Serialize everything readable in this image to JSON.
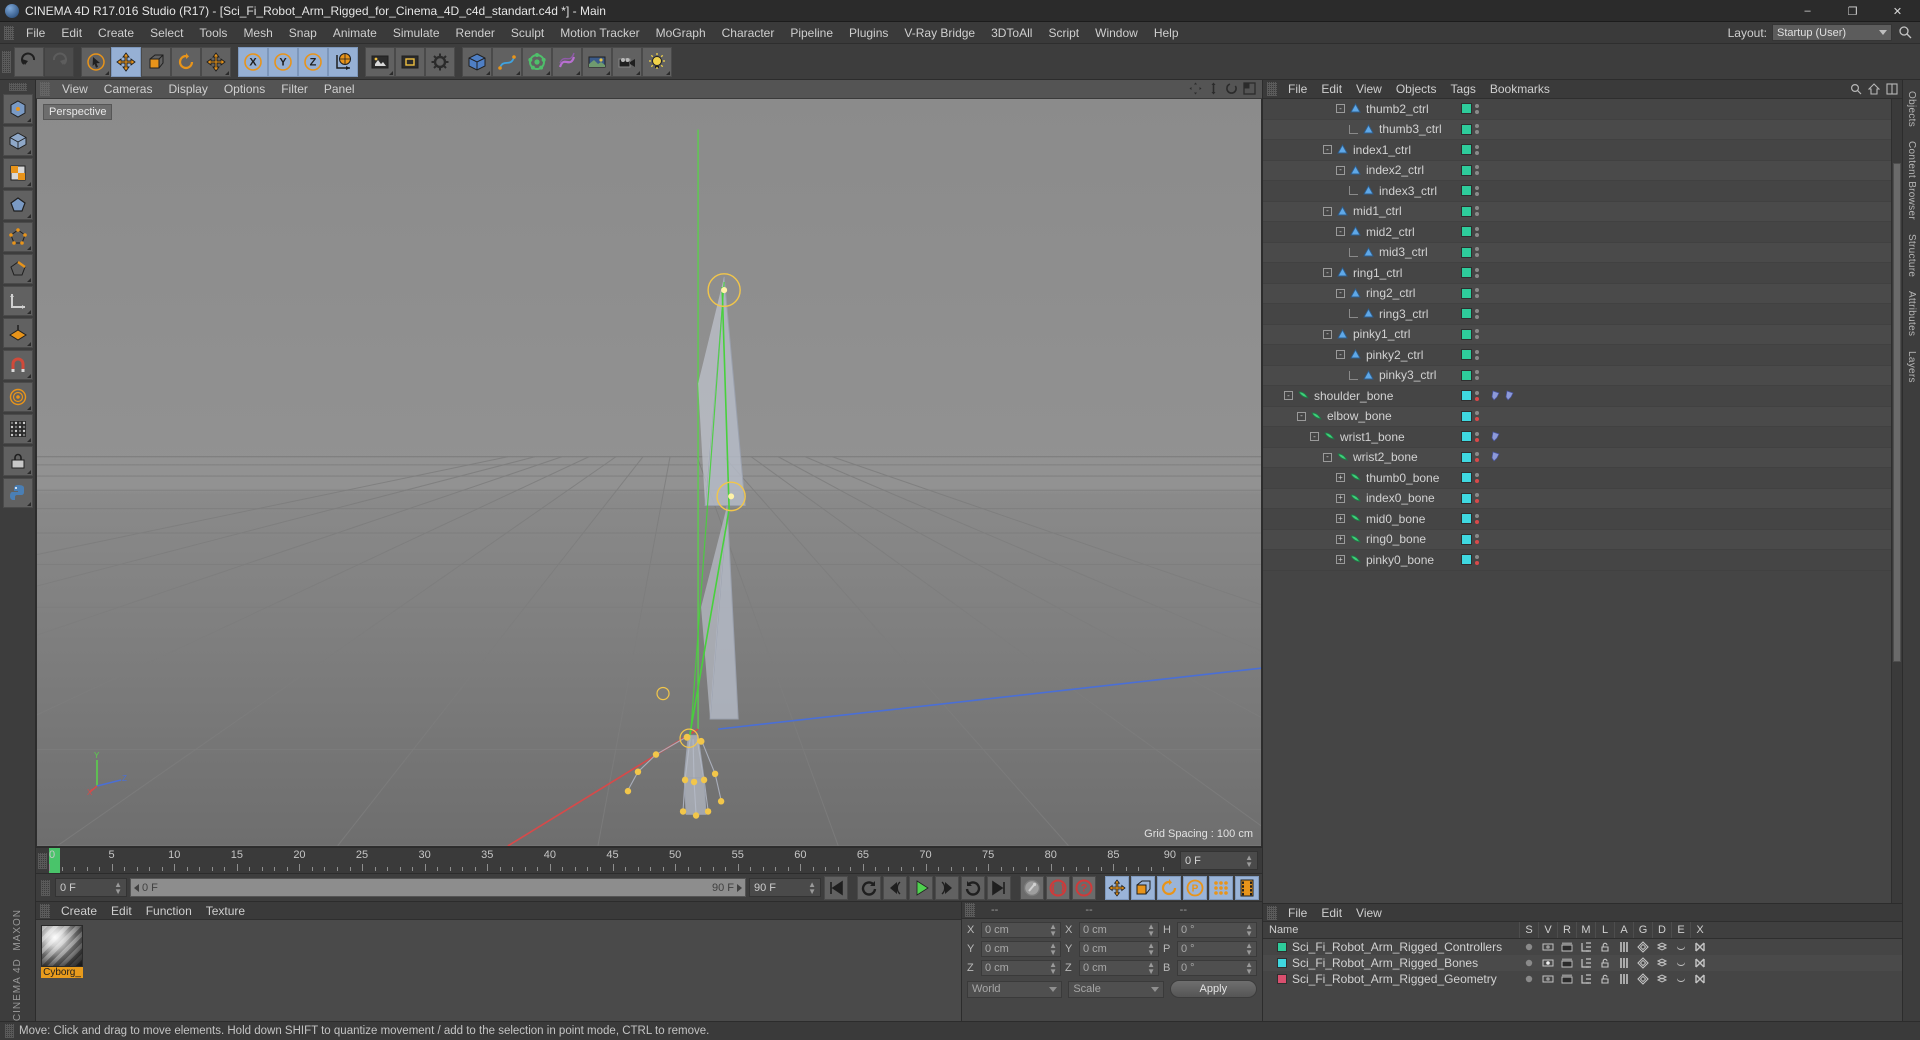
{
  "window": {
    "title": "CINEMA 4D R17.016 Studio (R17) - [Sci_Fi_Robot_Arm_Rigged_for_Cinema_4D_c4d_standart.c4d *] - Main",
    "minimize": "–",
    "maximize": "❐",
    "close": "✕",
    "brand_line1": "MAXON",
    "brand_line2": "CINEMA 4D"
  },
  "menubar": {
    "items": [
      "File",
      "Edit",
      "Create",
      "Select",
      "Tools",
      "Mesh",
      "Snap",
      "Animate",
      "Simulate",
      "Render",
      "Sculpt",
      "Motion Tracker",
      "MoGraph",
      "Character",
      "Pipeline",
      "Plugins",
      "V-Ray Bridge",
      "3DToAll",
      "Script",
      "Window",
      "Help"
    ],
    "layout_label": "Layout:",
    "layout_value": "Startup (User)",
    "search_icon": "search-icon"
  },
  "toolbar": {
    "groups": [
      {
        "buttons": [
          {
            "name": "undo-button",
            "icon": "undo-icon",
            "state": "normal"
          },
          {
            "name": "redo-button",
            "icon": "redo-icon",
            "state": "disabled"
          }
        ]
      },
      {
        "buttons": [
          {
            "name": "live-selection-button",
            "icon": "cursor-select-icon",
            "state": "normal",
            "corner": true
          },
          {
            "name": "move-tool-button",
            "icon": "move-arrows-icon",
            "state": "active"
          },
          {
            "name": "scale-tool-button",
            "icon": "scale-box-icon",
            "state": "normal"
          },
          {
            "name": "rotate-tool-button",
            "icon": "rotate-circle-icon",
            "state": "normal"
          },
          {
            "name": "move-variant-button",
            "icon": "move-arrows-icon",
            "state": "normal",
            "corner": true
          }
        ]
      },
      {
        "buttons": [
          {
            "name": "lock-x-axis-button",
            "icon": "axis-x-icon",
            "state": "active"
          },
          {
            "name": "lock-y-axis-button",
            "icon": "axis-y-icon",
            "state": "active"
          },
          {
            "name": "lock-z-axis-button",
            "icon": "axis-z-icon",
            "state": "active"
          },
          {
            "name": "world-coordinate-button",
            "icon": "globe-axis-icon",
            "state": "active"
          }
        ]
      },
      {
        "buttons": [
          {
            "name": "render-view-button",
            "icon": "render-frame-icon",
            "state": "normal",
            "corner": true
          },
          {
            "name": "render-region-button",
            "icon": "render-region-icon",
            "state": "normal"
          },
          {
            "name": "render-settings-button",
            "icon": "render-settings-icon",
            "state": "normal"
          }
        ]
      },
      {
        "buttons": [
          {
            "name": "add-cube-button",
            "icon": "cube-icon",
            "state": "normal",
            "corner": true
          },
          {
            "name": "add-spline-button",
            "icon": "spline-pen-icon",
            "state": "normal",
            "corner": true
          },
          {
            "name": "add-generator-button",
            "icon": "generator-icon",
            "state": "normal",
            "corner": true
          },
          {
            "name": "add-deformer-button",
            "icon": "deformer-icon",
            "state": "normal",
            "corner": true
          },
          {
            "name": "add-scene-object-button",
            "icon": "environment-icon",
            "state": "normal",
            "corner": true
          },
          {
            "name": "add-camera-button",
            "icon": "camera-icon",
            "state": "normal",
            "corner": true
          },
          {
            "name": "add-light-button",
            "icon": "light-icon",
            "state": "normal",
            "corner": true
          }
        ]
      }
    ]
  },
  "left_palette": {
    "buttons": [
      {
        "name": "make-editable-button",
        "icon": "make-editable-icon"
      },
      {
        "name": "model-mode-button",
        "icon": "model-cube-icon"
      },
      {
        "name": "texture-mode-button",
        "icon": "texture-checker-icon"
      },
      {
        "name": "polygon-mode-button",
        "icon": "polygon-icon"
      },
      {
        "name": "point-mode-button",
        "icon": "point-icon"
      },
      {
        "name": "edge-mode-button",
        "icon": "edge-icon"
      },
      {
        "name": "object-axis-button",
        "icon": "axis-corner-icon"
      },
      {
        "name": "workplane-button",
        "icon": "workplane-icon"
      },
      {
        "name": "snap-toggle-button",
        "icon": "snap-magnet-icon"
      },
      {
        "name": "soft-selection-button",
        "icon": "soft-selection-icon"
      },
      {
        "name": "viewport-solo-button",
        "icon": "solo-grid-icon"
      },
      {
        "name": "lock-selection-button",
        "icon": "lock-icon"
      },
      {
        "name": "python-button",
        "icon": "python-icon"
      }
    ]
  },
  "viewport": {
    "menu": [
      "View",
      "Cameras",
      "Display",
      "Options",
      "Filter",
      "Panel"
    ],
    "label": "Perspective",
    "grid_spacing": "Grid Spacing : 100 cm",
    "nav_icons": [
      "pan-icon",
      "zoom-icon",
      "rotate-icon",
      "maximize-viewport-icon"
    ],
    "axis_labels": {
      "y": "Y",
      "z": "Z",
      "x": "X"
    }
  },
  "timeline": {
    "start": 0,
    "end": 90,
    "major_ticks": [
      0,
      5,
      10,
      15,
      20,
      25,
      30,
      35,
      40,
      45,
      50,
      55,
      60,
      65,
      70,
      75,
      80,
      85,
      90
    ],
    "current_frame_field": "0 F",
    "playhead_frame": 0
  },
  "transport": {
    "current_frame": "0 F",
    "range_start": "0 F",
    "range_end": "90 F",
    "preview_end": "90 F",
    "buttons": [
      {
        "name": "go-to-start-button",
        "icon": "skip-start-icon"
      },
      {
        "name": "play-backwards-button",
        "icon": "rewind-loop-icon"
      },
      {
        "name": "previous-frame-button",
        "icon": "step-back-icon"
      },
      {
        "name": "play-forward-button",
        "icon": "play-icon"
      },
      {
        "name": "next-frame-button",
        "icon": "step-forward-icon"
      },
      {
        "name": "play-forward-loop-button",
        "icon": "forward-loop-icon"
      },
      {
        "name": "go-to-end-button",
        "icon": "skip-end-icon"
      },
      {
        "name": "record-active-objects-button",
        "icon": "record-key-icon"
      },
      {
        "name": "autokeying-button",
        "icon": "autokey-icon"
      },
      {
        "name": "keyframe-selection-button",
        "icon": "keyframe-question-icon"
      },
      {
        "name": "position-key-button",
        "icon": "position-key-icon"
      },
      {
        "name": "scale-key-button",
        "icon": "scale-key-icon"
      },
      {
        "name": "rotation-key-button",
        "icon": "rotation-key-icon"
      },
      {
        "name": "param-key-button",
        "icon": "param-key-icon"
      },
      {
        "name": "point-level-anim-button",
        "icon": "pla-dots-icon"
      },
      {
        "name": "timeline-button",
        "icon": "filmstrip-icon"
      }
    ]
  },
  "material_manager": {
    "menu": [
      "Create",
      "Edit",
      "Function",
      "Texture"
    ],
    "materials": [
      {
        "name": "Cyborg_",
        "selected": true
      }
    ]
  },
  "coordinate_manager": {
    "headers": [
      "--",
      "--",
      "--"
    ],
    "rows": [
      {
        "pos_label": "X",
        "pos_value": "0 cm",
        "size_label": "X",
        "size_value": "0 cm",
        "rot_label": "H",
        "rot_value": "0 °"
      },
      {
        "pos_label": "Y",
        "pos_value": "0 cm",
        "size_label": "Y",
        "size_value": "0 cm",
        "rot_label": "P",
        "rot_value": "0 °"
      },
      {
        "pos_label": "Z",
        "pos_value": "0 cm",
        "size_label": "Z",
        "size_value": "0 cm",
        "rot_label": "B",
        "rot_value": "0 °"
      }
    ],
    "coord_system": "World",
    "transform_mode": "Scale",
    "apply_label": "Apply"
  },
  "object_manager": {
    "menu": [
      "File",
      "Edit",
      "View",
      "Objects",
      "Tags",
      "Bookmarks"
    ],
    "rows": [
      {
        "label": "thumb2_ctrl",
        "type": "ctrl",
        "indent": 5,
        "expander": "-",
        "chip": "#2ecc9b",
        "tags": [
          "dot-gray",
          "dot-gray"
        ],
        "extra": []
      },
      {
        "label": "thumb3_ctrl",
        "type": "ctrl",
        "indent": 6,
        "expander": "leaf",
        "chip": "#2ecc9b",
        "tags": [
          "dot-gray",
          "dot-gray"
        ],
        "extra": []
      },
      {
        "label": "index1_ctrl",
        "type": "ctrl",
        "indent": 4,
        "expander": "-",
        "chip": "#2ecc9b",
        "tags": [
          "dot-gray",
          "dot-gray"
        ],
        "extra": []
      },
      {
        "label": "index2_ctrl",
        "type": "ctrl",
        "indent": 5,
        "expander": "-",
        "chip": "#2ecc9b",
        "tags": [
          "dot-gray",
          "dot-gray"
        ],
        "extra": []
      },
      {
        "label": "index3_ctrl",
        "type": "ctrl",
        "indent": 6,
        "expander": "leaf",
        "chip": "#2ecc9b",
        "tags": [
          "dot-gray",
          "dot-gray"
        ],
        "extra": []
      },
      {
        "label": "mid1_ctrl",
        "type": "ctrl",
        "indent": 4,
        "expander": "-",
        "chip": "#2ecc9b",
        "tags": [
          "dot-gray",
          "dot-gray"
        ],
        "extra": []
      },
      {
        "label": "mid2_ctrl",
        "type": "ctrl",
        "indent": 5,
        "expander": "-",
        "chip": "#2ecc9b",
        "tags": [
          "dot-gray",
          "dot-gray"
        ],
        "extra": []
      },
      {
        "label": "mid3_ctrl",
        "type": "ctrl",
        "indent": 6,
        "expander": "leaf",
        "chip": "#2ecc9b",
        "tags": [
          "dot-gray",
          "dot-gray"
        ],
        "extra": []
      },
      {
        "label": "ring1_ctrl",
        "type": "ctrl",
        "indent": 4,
        "expander": "-",
        "chip": "#2ecc9b",
        "tags": [
          "dot-gray",
          "dot-gray"
        ],
        "extra": []
      },
      {
        "label": "ring2_ctrl",
        "type": "ctrl",
        "indent": 5,
        "expander": "-",
        "chip": "#2ecc9b",
        "tags": [
          "dot-gray",
          "dot-gray"
        ],
        "extra": []
      },
      {
        "label": "ring3_ctrl",
        "type": "ctrl",
        "indent": 6,
        "expander": "leaf",
        "chip": "#2ecc9b",
        "tags": [
          "dot-gray",
          "dot-gray"
        ],
        "extra": []
      },
      {
        "label": "pinky1_ctrl",
        "type": "ctrl",
        "indent": 4,
        "expander": "-",
        "chip": "#2ecc9b",
        "tags": [
          "dot-gray",
          "dot-gray"
        ],
        "extra": []
      },
      {
        "label": "pinky2_ctrl",
        "type": "ctrl",
        "indent": 5,
        "expander": "-",
        "chip": "#2ecc9b",
        "tags": [
          "dot-gray",
          "dot-gray"
        ],
        "extra": []
      },
      {
        "label": "pinky3_ctrl",
        "type": "ctrl",
        "indent": 6,
        "expander": "leaf",
        "chip": "#2ecc9b",
        "tags": [
          "dot-gray",
          "dot-gray"
        ],
        "extra": []
      },
      {
        "label": "shoulder_bone",
        "type": "bone",
        "indent": 1,
        "expander": "-",
        "chip": "#3fd8e0",
        "tags": [
          "dot-gray",
          "dot-red"
        ],
        "extra": [
          "constraint-tag",
          "ik-tag"
        ]
      },
      {
        "label": "elbow_bone",
        "type": "bone",
        "indent": 2,
        "expander": "-",
        "chip": "#3fd8e0",
        "tags": [
          "dot-gray",
          "dot-red"
        ],
        "extra": []
      },
      {
        "label": "wrist1_bone",
        "type": "bone",
        "indent": 3,
        "expander": "-",
        "chip": "#3fd8e0",
        "tags": [
          "dot-gray",
          "dot-red"
        ],
        "extra": [
          "constraint-tag"
        ]
      },
      {
        "label": "wrist2_bone",
        "type": "bone",
        "indent": 4,
        "expander": "-",
        "chip": "#3fd8e0",
        "tags": [
          "dot-gray",
          "dot-red"
        ],
        "extra": [
          "constraint-tag"
        ]
      },
      {
        "label": "thumb0_bone",
        "type": "bone",
        "indent": 5,
        "expander": "+",
        "chip": "#3fd8e0",
        "tags": [
          "dot-gray",
          "dot-red"
        ],
        "extra": []
      },
      {
        "label": "index0_bone",
        "type": "bone",
        "indent": 5,
        "expander": "+",
        "chip": "#3fd8e0",
        "tags": [
          "dot-gray",
          "dot-red"
        ],
        "extra": []
      },
      {
        "label": "mid0_bone",
        "type": "bone",
        "indent": 5,
        "expander": "+",
        "chip": "#3fd8e0",
        "tags": [
          "dot-gray",
          "dot-red"
        ],
        "extra": []
      },
      {
        "label": "ring0_bone",
        "type": "bone",
        "indent": 5,
        "expander": "+",
        "chip": "#3fd8e0",
        "tags": [
          "dot-gray",
          "dot-red"
        ],
        "extra": []
      },
      {
        "label": "pinky0_bone",
        "type": "bone",
        "indent": 5,
        "expander": "+",
        "chip": "#3fd8e0",
        "tags": [
          "dot-gray",
          "dot-red"
        ],
        "extra": []
      }
    ]
  },
  "layer_manager": {
    "menu": [
      "File",
      "Edit",
      "View"
    ],
    "name_column": "Name",
    "columns": [
      "S",
      "V",
      "R",
      "M",
      "L",
      "A",
      "G",
      "D",
      "E",
      "X"
    ],
    "rows": [
      {
        "label": "Sci_Fi_Robot_Arm_Rigged_Controllers",
        "color": "#2ecc9b",
        "view_on": false
      },
      {
        "label": "Sci_Fi_Robot_Arm_Rigged_Bones",
        "color": "#3fd8e0",
        "view_on": true
      },
      {
        "label": "Sci_Fi_Robot_Arm_Rigged_Geometry",
        "color": "#d94f6e",
        "view_on": false
      }
    ]
  },
  "right_tabs": [
    {
      "label": "Objects",
      "name": "vtab-objects"
    },
    {
      "label": "Content Browser",
      "name": "vtab-content-browser"
    },
    {
      "label": "Structure",
      "name": "vtab-structure"
    },
    {
      "label": "Attributes",
      "name": "vtab-attributes"
    },
    {
      "label": "Layers",
      "name": "vtab-layers"
    }
  ],
  "statusbar": {
    "text": "Move: Click and drag to move elements. Hold down SHIFT to quantize movement / add to the selection in point mode, CTRL to remove."
  }
}
